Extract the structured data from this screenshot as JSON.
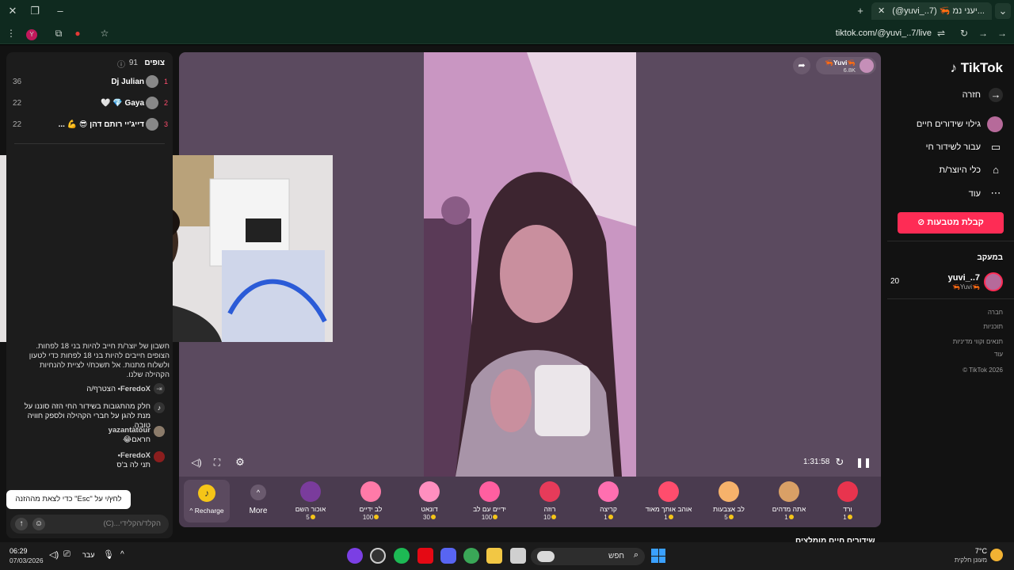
{
  "browser": {
    "tabs": [
      {
        "label": "(@yuvi_..7) 🦐 יעני נמ..."
      },
      {
        "label": ""
      }
    ],
    "url": "tiktok.com/@yuvi_..7/live"
  },
  "chat": {
    "viewers_label": "צופים",
    "viewers_count": "91",
    "top_viewers": [
      {
        "rank": "1",
        "name": "Dj Julian",
        "count": "36"
      },
      {
        "rank": "2",
        "name": "🤍 💎 Gaya",
        "count": "22"
      },
      {
        "rank": "3",
        "name": "... 💪 😎 דייג'יי רותם דהן",
        "count": "22"
      }
    ],
    "rules_text": "חשבון של יוצר/ת חייב להיות בני 18 לפחות. הצופים חייבים להיות בני 18 לפחות כדי לטעון ולשלוח מתנות. אל תשכח/י לציית להנחיות הקהילה שלנו.",
    "messages": [
      {
        "user": "FeredoX•",
        "text": "הצטרף/ה"
      },
      {
        "user": "",
        "text": "חלק מהתגובות בשידור החי הזה סוננו על מנת להגן על חברי הקהילה ולספק חוויה טובה."
      },
      {
        "user": "yazantatour",
        "text": "חראם😂"
      },
      {
        "user": "FeredoX•",
        "text": "תני לה ב'ס"
      }
    ],
    "esc_hint": "לחץ/י על \"Esc\" כדי לצאת מההזנה",
    "input_placeholder": "הקלד/הקלידי...(C)"
  },
  "stream": {
    "host_name": "🦐Yuvi🦐",
    "host_likes": "6.8K",
    "timer": "1:31:58"
  },
  "gifts": {
    "recharge_label": "Recharge",
    "more_label": "More",
    "items": [
      {
        "name": "אוכור השם",
        "price": "5",
        "color": "#7a3c9c"
      },
      {
        "name": "לב ידיים",
        "price": "100",
        "color": "#ff7aa8"
      },
      {
        "name": "דונאט",
        "price": "30",
        "color": "#ff8fbf"
      },
      {
        "name": "ידיים עם לב",
        "price": "100",
        "color": "#ff5fa0"
      },
      {
        "name": "רוזה",
        "price": "10",
        "color": "#e63b5a"
      },
      {
        "name": "קריצה",
        "price": "1",
        "color": "#ff6fb0"
      },
      {
        "name": "אוהב אותך מאוד",
        "price": "1",
        "color": "#ff4d6d"
      },
      {
        "name": "לב אצבעות",
        "price": "5",
        "color": "#f6b26b"
      },
      {
        "name": "אתה מדהים",
        "price": "1",
        "color": "#d9a066"
      },
      {
        "name": "ורד",
        "price": "1",
        "color": "#e8344e"
      }
    ]
  },
  "sidebar": {
    "logo": "TikTok",
    "nav": [
      {
        "label": "חזרה"
      },
      {
        "label": "גילוי שידורים חיים"
      },
      {
        "label": "עבור לשידור חי"
      },
      {
        "label": "כלי היוצר/ת"
      },
      {
        "label": "עוד"
      }
    ],
    "coins_button": "קבלת מטבעות",
    "following_title": "במעקב",
    "following": {
      "name": "yuvi_..7",
      "sub": "🦐Yuvi🦐",
      "count": "20"
    },
    "footer": [
      "חברה",
      "תוכניות",
      "תנאים וקווי מדיניות",
      "עוד",
      "© TikTok 2026"
    ],
    "section_title": "שידורים חיים מומלצים"
  },
  "taskbar": {
    "search_placeholder": "חפש",
    "weather_temp": "7°C",
    "weather_desc": "מעונן חלקית",
    "lang": "עבר",
    "time": "06:29",
    "date": "07/03/2026"
  }
}
